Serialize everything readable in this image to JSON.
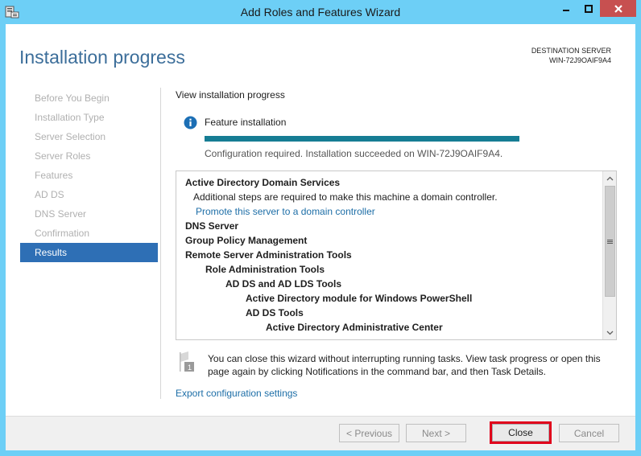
{
  "window": {
    "title": "Add Roles and Features Wizard",
    "controls": {
      "minimize": "minimize",
      "maximize": "maximize",
      "close": "close"
    }
  },
  "header": {
    "page_title": "Installation progress",
    "destination_label": "DESTINATION SERVER",
    "destination_server": "WIN-72J9OAIF9A4"
  },
  "nav": {
    "items": [
      {
        "label": "Before You Begin",
        "active": false
      },
      {
        "label": "Installation Type",
        "active": false
      },
      {
        "label": "Server Selection",
        "active": false
      },
      {
        "label": "Server Roles",
        "active": false
      },
      {
        "label": "Features",
        "active": false
      },
      {
        "label": "AD DS",
        "active": false
      },
      {
        "label": "DNS Server",
        "active": false
      },
      {
        "label": "Confirmation",
        "active": false
      },
      {
        "label": "Results",
        "active": true
      }
    ]
  },
  "main": {
    "section_label": "View installation progress",
    "feature_label": "Feature installation",
    "progress_fraction": 1.0,
    "status": "Configuration required. Installation succeeded on WIN-72J9OAIF9A4.",
    "results": [
      {
        "text": "Active Directory Domain Services",
        "bold": true,
        "link": false,
        "indent": 0
      },
      {
        "text": "Additional steps are required to make this machine a domain controller.",
        "bold": false,
        "link": false,
        "indent": 1
      },
      {
        "text": "Promote this server to a domain controller",
        "bold": false,
        "link": true,
        "indent": 1
      },
      {
        "text": "DNS Server",
        "bold": true,
        "link": false,
        "indent": 0
      },
      {
        "text": "Group Policy Management",
        "bold": true,
        "link": false,
        "indent": 0
      },
      {
        "text": "Remote Server Administration Tools",
        "bold": true,
        "link": false,
        "indent": 0
      },
      {
        "text": "Role Administration Tools",
        "bold": true,
        "link": false,
        "indent": 1
      },
      {
        "text": "AD DS and AD LDS Tools",
        "bold": true,
        "link": false,
        "indent": 2
      },
      {
        "text": "Active Directory module for Windows PowerShell",
        "bold": true,
        "link": false,
        "indent": 3
      },
      {
        "text": "AD DS Tools",
        "bold": true,
        "link": false,
        "indent": 3
      },
      {
        "text": "Active Directory Administrative Center",
        "bold": true,
        "link": false,
        "indent": 4
      }
    ],
    "note": "You can close this wizard without interrupting running tasks. View task progress or open this page again by clicking Notifications in the command bar, and then Task Details.",
    "export_link": "Export configuration settings"
  },
  "footer": {
    "previous": "< Previous",
    "next": "Next >",
    "close": "Close",
    "cancel": "Cancel"
  },
  "colors": {
    "title_bar": "#6dcff6",
    "accent_title": "#3c6e9a",
    "nav_active": "#2e6fb5",
    "progress": "#167d94",
    "link": "#1d6ea7",
    "highlight": "#e0001b"
  }
}
